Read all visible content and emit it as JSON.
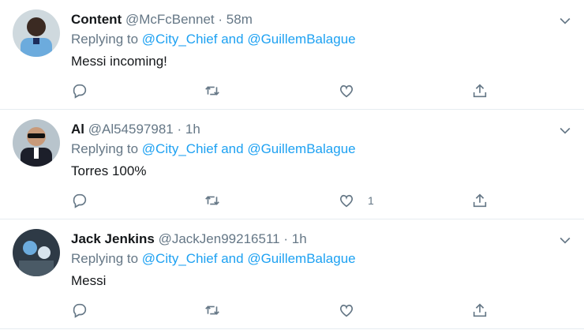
{
  "colors": {
    "accent": "#1da1f2",
    "muted": "#657786",
    "text": "#14171a",
    "divider": "#e6ecf0"
  },
  "tweets": [
    {
      "name": "Content",
      "handle": "@McFcBennet",
      "dot": "·",
      "time": "58m",
      "replying_prefix": "Replying to",
      "mention1": "@City_Chief",
      "and": "and",
      "mention2": "@GuillemBalague",
      "text": "Messi incoming!",
      "like_count": ""
    },
    {
      "name": "Al",
      "handle": "@Al54597981",
      "dot": "·",
      "time": "1h",
      "replying_prefix": "Replying to",
      "mention1": "@City_Chief",
      "and": "and",
      "mention2": "@GuillemBalague",
      "text": "Torres 100%",
      "like_count": "1"
    },
    {
      "name": "Jack Jenkins",
      "handle": "@JackJen99216511",
      "dot": "·",
      "time": "1h",
      "replying_prefix": "Replying to",
      "mention1": "@City_Chief",
      "and": "and",
      "mention2": "@GuillemBalague",
      "text": "Messi",
      "like_count": ""
    }
  ],
  "icons": [
    "reply-icon",
    "retweet-icon",
    "like-icon",
    "share-icon",
    "chevron-down-icon"
  ]
}
